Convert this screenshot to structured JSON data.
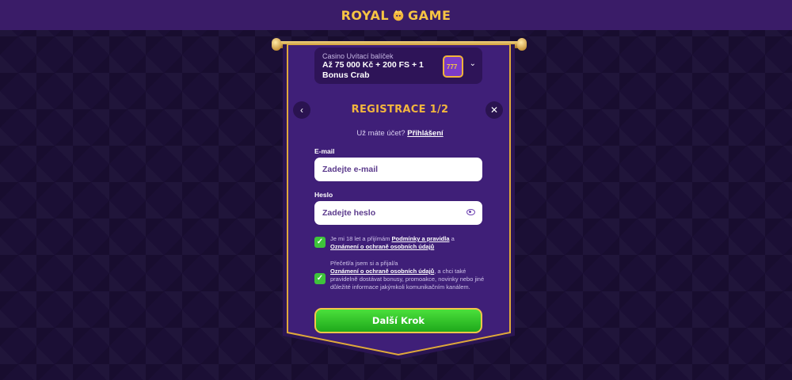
{
  "brand": {
    "name_left": "ROYAL",
    "name_right": "GAME",
    "gold": "#f3b63d",
    "purple": "#3a1c68",
    "green": "#3ec43b"
  },
  "bonus": {
    "title": "Casino Uvítací balíček",
    "value": "Až 75 000 Kč + 200 FS + 1 Bonus Crab",
    "slot_text": "777"
  },
  "form": {
    "title": "REGISTRACE 1/2",
    "login_prompt": "Už máte účet?",
    "login_link": "Přihlášení",
    "email_label": "E-mail",
    "email_placeholder": "Zadejte e-mail",
    "password_label": "Heslo",
    "password_placeholder": "Zadejte heslo",
    "consent1": {
      "pre": "Je mi 18 let a přijímám",
      "link1": "Podmínky a pravidla",
      "mid": "a",
      "link2": "Oznámení o ochraně osobních údajů"
    },
    "consent2": {
      "pre": "Přečetl/a jsem si a přijal/a",
      "link": "Oznámení o ochraně osobních údajů",
      "post": ", a chci také pravidelně dostávat bonusy, promoakce, novinky nebo jiné důležité informace jakýmkoli komunikačním kanálem."
    },
    "submit_label": "Další Krok"
  }
}
